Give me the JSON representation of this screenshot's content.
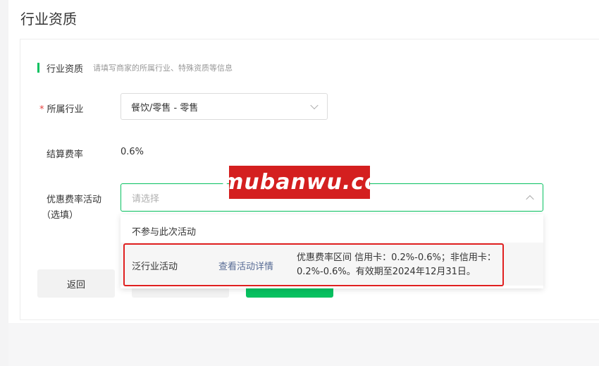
{
  "page": {
    "title": "行业资质"
  },
  "section": {
    "title": "行业资质",
    "desc": "请填写商家的所属行业、特殊资质等信息"
  },
  "industry": {
    "required_mark": "*",
    "label": "所属行业",
    "value": "餐饮/零售 - 零售"
  },
  "rate": {
    "label": "结算费率",
    "value": "0.6%"
  },
  "promo": {
    "label_line1": "优惠费率活动",
    "label_line2": "（选填）",
    "placeholder": "请选择",
    "options": [
      {
        "title": "不参与此次活动"
      },
      {
        "title": "泛行业活动",
        "link": "查看活动详情",
        "desc": "优惠费率区间 信用卡：0.2%-0.6%；非信用卡：0.2%-0.6%。有效期至2024年12月31日。"
      }
    ]
  },
  "buttons": {
    "back": "返回"
  },
  "watermark": {
    "text": "mubanwu.cc"
  },
  "colors": {
    "accent": "#07c160",
    "highlight": "#e02020",
    "link": "#576b95"
  }
}
